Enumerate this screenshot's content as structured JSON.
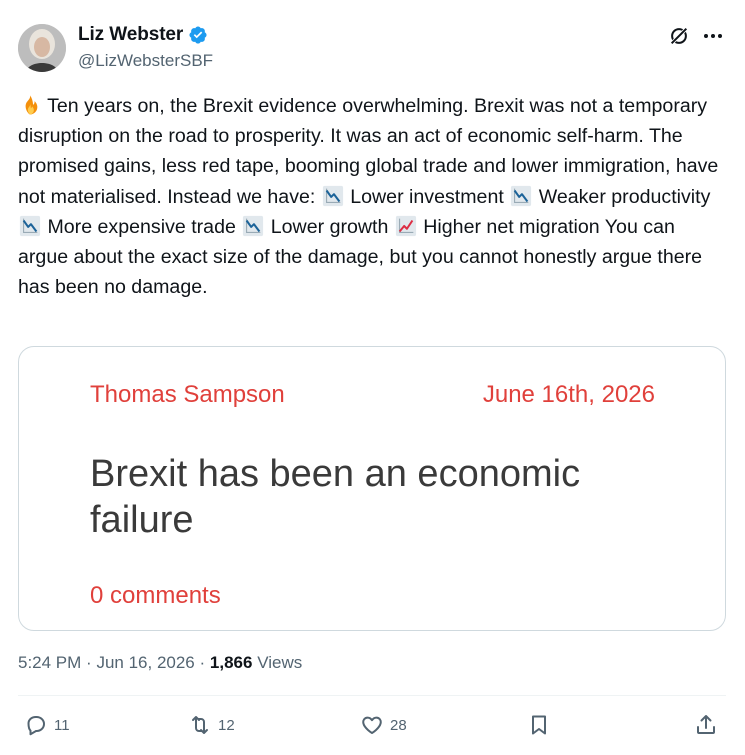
{
  "author": {
    "display_name": "Liz Webster",
    "handle": "@LizWebsterSBF",
    "verified": true
  },
  "tweet": {
    "segments": [
      {
        "emoji": "fire-icon"
      },
      {
        "text": " Ten years on, the Brexit evidence overwhelming. Brexit was not a temporary disruption on the road to prosperity. It was an act of economic self-harm. The promised gains, less red tape, booming global trade and lower immigration, have not materialised. Instead we have: "
      },
      {
        "emoji": "chart-decreasing-icon"
      },
      {
        "text": " Lower investment "
      },
      {
        "emoji": "chart-decreasing-icon"
      },
      {
        "text": " Weaker productivity "
      },
      {
        "emoji": "chart-decreasing-icon"
      },
      {
        "text": " More expensive trade "
      },
      {
        "emoji": "chart-decreasing-icon"
      },
      {
        "text": " Lower growth "
      },
      {
        "emoji": "chart-increasing-icon"
      },
      {
        "text": " Higher net migration You can argue about the exact size of the damage, but you cannot honestly argue there has been no damage."
      }
    ]
  },
  "card": {
    "author": "Thomas Sampson",
    "date": "June 16th, 2026",
    "title": "Brexit has been an economic failure",
    "comments": "0 comments"
  },
  "meta": {
    "time": "5:24 PM",
    "separator": "·",
    "date": "Jun 16, 2026",
    "views_count": "1,866",
    "views_label": "Views"
  },
  "actions": {
    "replies": "11",
    "reposts": "12",
    "likes": "28"
  },
  "colors": {
    "accent_red": "#e0403b",
    "verified_blue": "#1d9bf0",
    "muted": "#536471"
  }
}
